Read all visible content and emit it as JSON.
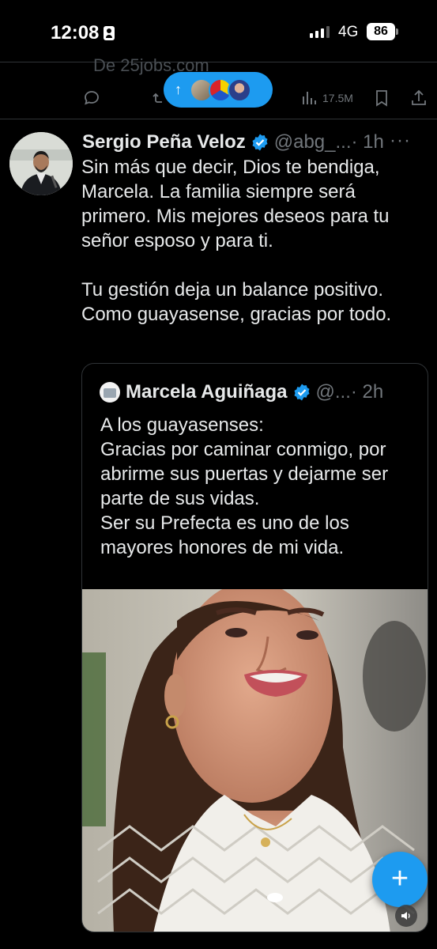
{
  "status_bar": {
    "time": "12:08",
    "network": "4G",
    "battery": "86"
  },
  "previous_post": {
    "text_fragment": "De 25jobs.com",
    "views": "17.5M"
  },
  "new_posts_pill": {
    "arrow": "↑"
  },
  "post": {
    "author_name": "Sergio Peña Veloz",
    "author_handle": "@abg_...",
    "time": "· 1h",
    "more": "···",
    "paragraphs": [
      "Sin más que decir, Dios te bendiga, Marcela. La familia siempre será primero. Mis mejores deseos para tu señor esposo y para ti.",
      "Tu gestión deja un balance positivo. Como guayasense, gracias por todo."
    ]
  },
  "quoted_post": {
    "author_name": "Marcela Aguiñaga",
    "author_handle": "@...",
    "time": "· 2h",
    "text": "A los guayasenses:\nGracias por caminar conmigo, por abrirme sus puertas y dejarme ser parte de sus vidas.\nSer su Prefecta es uno de los mayores honores de mi vida."
  },
  "fab": {
    "label": "+"
  },
  "colors": {
    "accent": "#1d9bf0",
    "background": "#000000",
    "text": "#e7e9ea",
    "secondary_text": "#71767b",
    "border": "#2f3336"
  }
}
